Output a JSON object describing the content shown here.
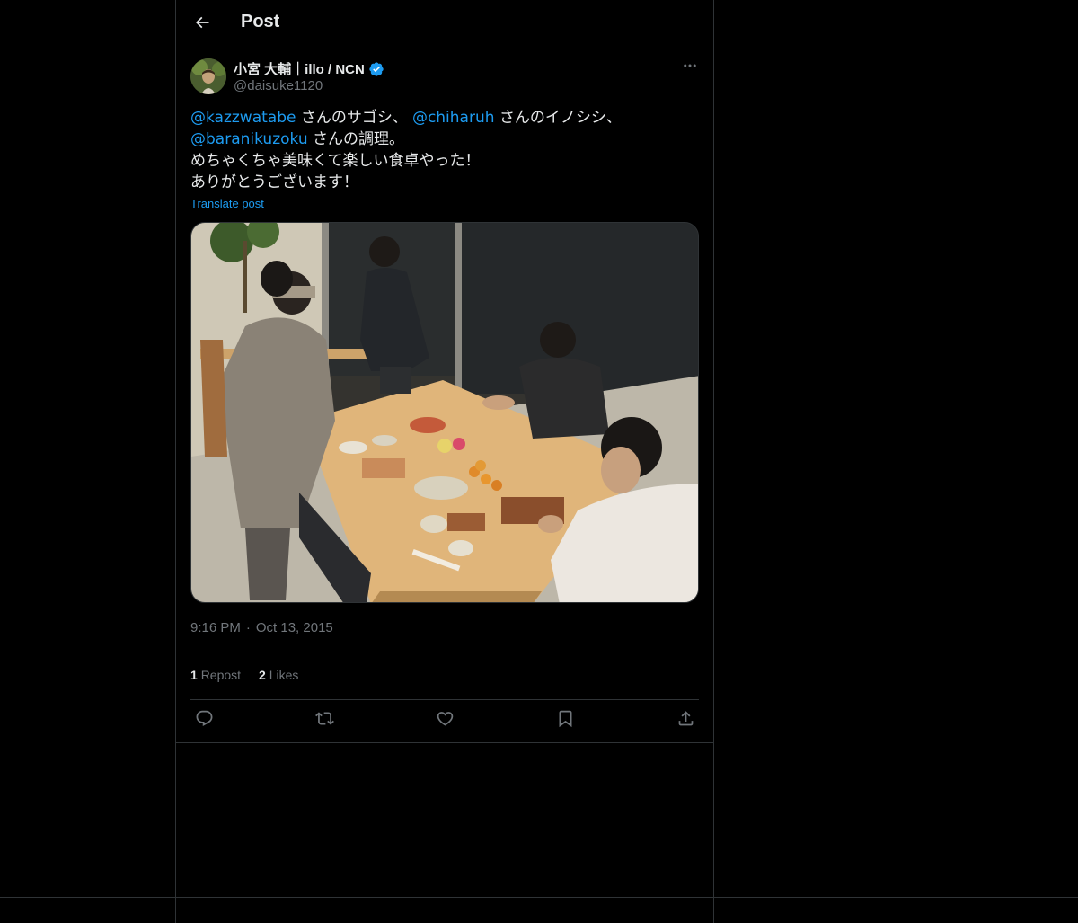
{
  "header": {
    "title": "Post",
    "back_icon": "arrow-left-icon"
  },
  "author": {
    "name": "小宮 大輔｜illo / NCN",
    "handle": "@daisuke1120",
    "verified_icon": "verified-badge-icon",
    "more_icon": "more-horizontal-icon"
  },
  "tweet": {
    "line1": {
      "mention1": "@kazzwatabe",
      "text1": " さんのサゴシ、 ",
      "mention2": "@chiharuh",
      "text2": " さんのイノシシ、"
    },
    "line2": {
      "mention3": "@baranikuzoku",
      "text3": " さんの調理。"
    },
    "line3": "めちゃくちゃ美味くて楽しい食卓やった！",
    "line4": "ありがとうございます！",
    "translate": "Translate post"
  },
  "meta": {
    "time": "9:16 PM",
    "separator": "·",
    "date": "Oct 13, 2015"
  },
  "stats": {
    "reposts_count": "1",
    "reposts_label": "Repost",
    "likes_count": "2",
    "likes_label": "Likes"
  },
  "actions": {
    "reply_icon": "reply-icon",
    "repost_icon": "repost-icon",
    "like_icon": "heart-icon",
    "bookmark_icon": "bookmark-icon",
    "share_icon": "share-icon"
  },
  "colors": {
    "background": "#000000",
    "text": "#e7e9ea",
    "muted": "#71767b",
    "accent": "#1d9bf0",
    "border": "#2f3336"
  }
}
